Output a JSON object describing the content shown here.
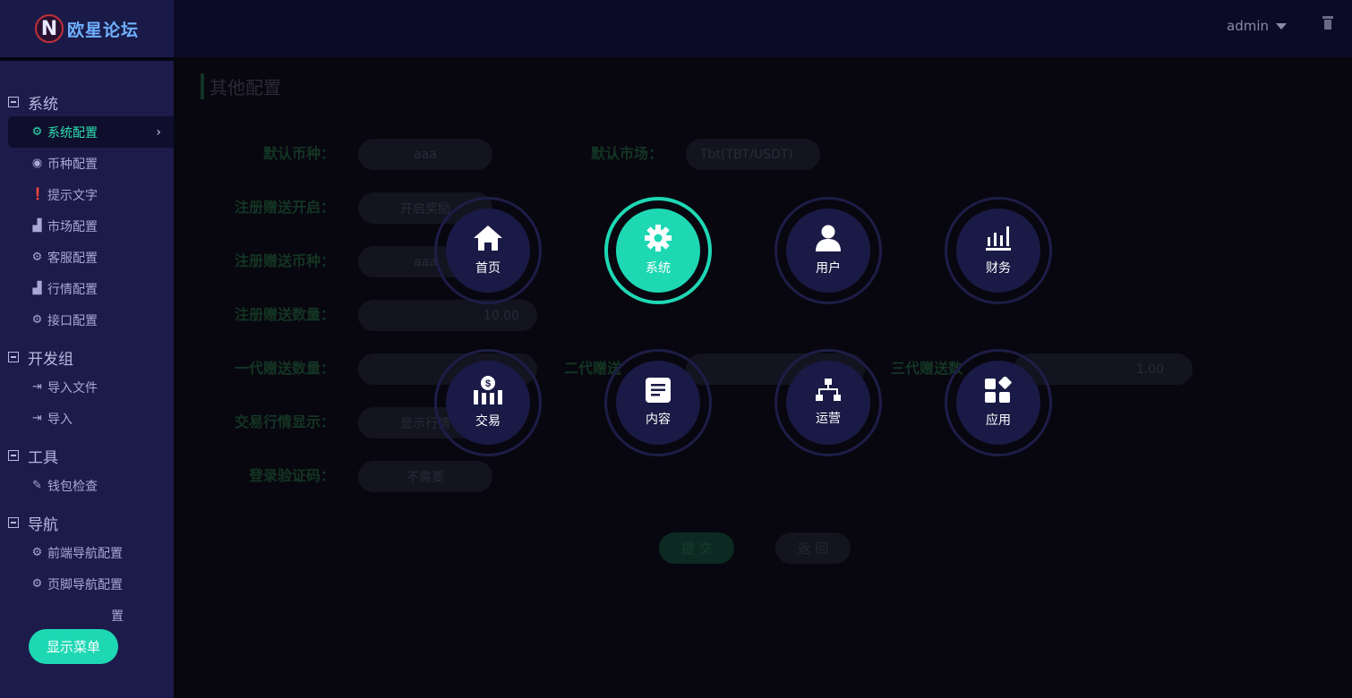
{
  "header": {
    "logo_text": "欧星论坛",
    "logo_mark": "N",
    "user": "admin"
  },
  "sidebar": {
    "groups": [
      {
        "label": "系统",
        "items": [
          {
            "label": "系统配置",
            "icon": "gear-icon"
          },
          {
            "label": "币种配置",
            "icon": "target-icon"
          },
          {
            "label": "提示文字",
            "icon": "info-icon"
          },
          {
            "label": "市场配置",
            "icon": "bar-chart-icon"
          },
          {
            "label": "客服配置",
            "icon": "gear-icon"
          },
          {
            "label": "行情配置",
            "icon": "bar-chart-icon"
          },
          {
            "label": "接口配置",
            "icon": "gear-icon"
          }
        ]
      },
      {
        "label": "开发组",
        "items": [
          {
            "label": "导入文件",
            "icon": "sign-in-icon"
          },
          {
            "label": "导入",
            "icon": "sign-in-icon"
          }
        ]
      },
      {
        "label": "工具",
        "items": [
          {
            "label": "钱包检查",
            "icon": "wrench-icon"
          }
        ]
      },
      {
        "label": "导航",
        "items": [
          {
            "label": "前端导航配置",
            "icon": "gear-icon"
          },
          {
            "label": "页脚导航配置",
            "icon": "gear-icon"
          },
          {
            "label": "置",
            "icon": "gear-icon"
          }
        ]
      }
    ],
    "show_menu_button": "显示菜单"
  },
  "form": {
    "title": "其他配置",
    "labels": {
      "default_coin": "默认币种：",
      "default_market": "默认市场：",
      "reg_gift_open": "注册赠送开启：",
      "reg_gift_coin": "注册赠送币种：",
      "reg_gift_amount": "注册赠送数量：",
      "gen1": "一代赠送数量：",
      "gen2": "二代赠送",
      "gen3": "三代赠送数",
      "trade_quote": "交易行情显示：",
      "login_captcha": "登录验证码："
    },
    "values": {
      "default_coin": "aaa",
      "default_market": "Tbt(TBT/USDT)",
      "reg_gift_open": "开启奖励",
      "reg_gift_coin": "aaa",
      "reg_gift_amount": "10.00",
      "gen3": "1.00",
      "trade_quote": "显示行情",
      "login_captcha": "不需要"
    },
    "submit": "提 交",
    "back": "返 回"
  },
  "quick_menu": [
    {
      "label": "首页",
      "icon": "home-icon"
    },
    {
      "label": "系统",
      "icon": "gear-icon"
    },
    {
      "label": "用户",
      "icon": "user-icon"
    },
    {
      "label": "财务",
      "icon": "finance-chart-icon"
    },
    {
      "label": "交易",
      "icon": "money-bars-icon"
    },
    {
      "label": "内容",
      "icon": "document-icon"
    },
    {
      "label": "运营",
      "icon": "sitemap-icon"
    },
    {
      "label": "应用",
      "icon": "apps-icon"
    }
  ],
  "colors": {
    "accent": "#1ed8b4",
    "sidebar": "#1c1b4a",
    "topbar": "#0c0a26"
  }
}
